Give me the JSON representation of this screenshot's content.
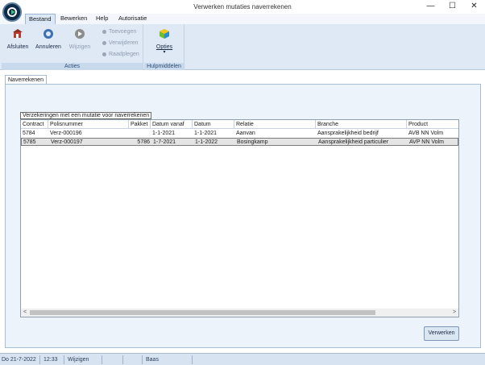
{
  "window": {
    "title": "Verwerken mutaties naverrekenen",
    "controls": {
      "minimize": "—",
      "maximize": "☐",
      "close": "✕"
    }
  },
  "menu": {
    "tabs": [
      "Bestand",
      "Bewerken",
      "Help",
      "Autorisatie"
    ],
    "active": "Bestand"
  },
  "ribbon": {
    "acties": {
      "label": "Acties",
      "afsluiten": "Afsluiten",
      "annuleren": "Annuleren",
      "wijzigen": "Wijzigen",
      "toevoegen": "Toevoegen",
      "verwijderen": "Verwijderen",
      "raadplegen": "Raadplegen"
    },
    "hulpmiddelen": {
      "label": "Hulpmiddelen",
      "opties": "Opties",
      "opties_arrow": "▾"
    }
  },
  "doc_tab": {
    "label": "Naverrekenen"
  },
  "grid": {
    "title": "Verzekeringen met een mutatie voor naverrekenen",
    "columns": [
      "Contract",
      "Polisnummer",
      "Pakket",
      "Datum vanaf",
      "Datum",
      "Relatie",
      "Branche",
      "Product"
    ],
    "rows": [
      [
        "5784",
        "Verz-000196",
        "",
        "1-1-2021",
        "1-1-2021",
        "Aanvan",
        "Aansprakelijkheid bedrijf",
        "AVB NN Volm"
      ],
      [
        "5785",
        "Verz-000197",
        "5786",
        "1-7-2021",
        "1-1-2022",
        "Bosingkamp",
        "Aansprakelijkheid particulier",
        "AVP NN Volm"
      ]
    ],
    "selected_row": 1,
    "scroll_left": "<",
    "scroll_right": ">"
  },
  "buttons": {
    "verwerken": "Verwerken"
  },
  "status": {
    "date": "Do 21-7-2022",
    "time": "12:33",
    "mode": "Wijzigen",
    "empty1": "",
    "empty2": "",
    "user": "Baas"
  },
  "colors": {
    "ribbon_bg": "#dfe9f5",
    "group_label_text": "#2c4f78",
    "selected_row_bg": "#e4e4e4",
    "status_bg": "#d7e3f1"
  }
}
